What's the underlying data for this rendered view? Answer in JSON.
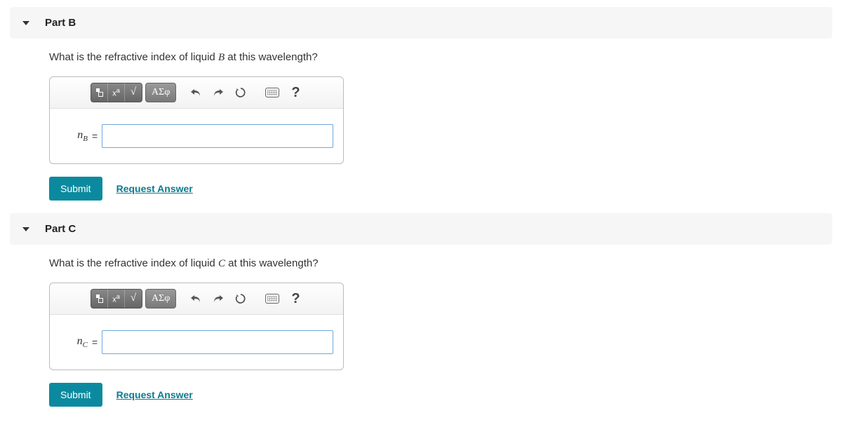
{
  "parts": {
    "b": {
      "title": "Part B",
      "question_pre": "What is the refractive index of liquid ",
      "question_var": "B",
      "question_post": " at this wavelength?",
      "var_label_base": "n",
      "var_label_sub": "B",
      "eq": "=",
      "input_value": "",
      "submit": "Submit",
      "request": "Request Answer"
    },
    "c": {
      "title": "Part C",
      "question_pre": "What is the refractive index of liquid ",
      "question_var": "C",
      "question_post": " at this wavelength?",
      "var_label_base": "n",
      "var_label_sub": "C",
      "eq": "=",
      "input_value": "",
      "submit": "Submit",
      "request": "Request Answer"
    }
  },
  "toolbar": {
    "sigma_label": "ΑΣφ",
    "help_label": "?"
  }
}
